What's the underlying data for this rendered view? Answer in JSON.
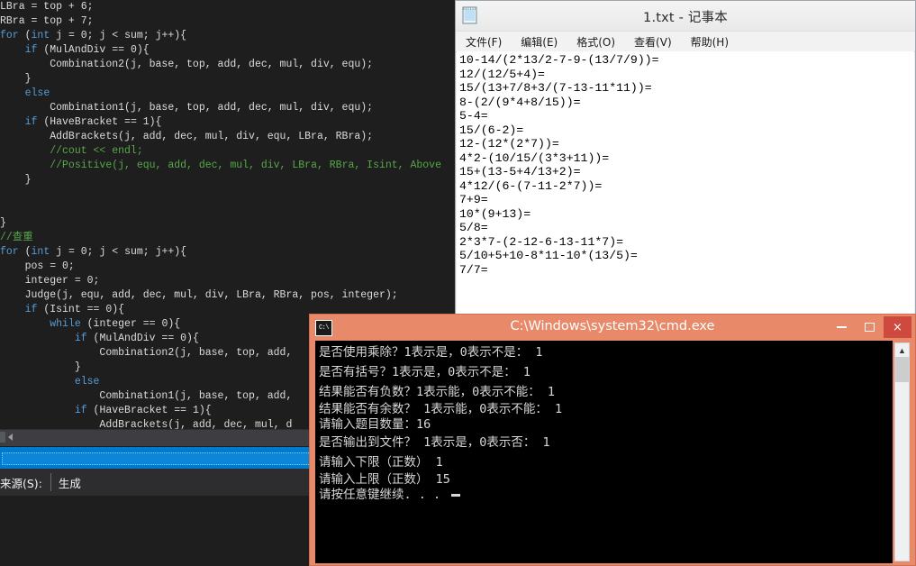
{
  "vs": {
    "code_lines": [
      [
        {
          "t": "LBra = top + 6;",
          "c": ""
        }
      ],
      [
        {
          "t": "RBra = top + 7;",
          "c": ""
        }
      ],
      [
        {
          "t": "for",
          "c": "k"
        },
        {
          "t": " (",
          "c": ""
        },
        {
          "t": "int",
          "c": "k"
        },
        {
          "t": " j = 0; j < sum; j++){",
          "c": ""
        }
      ],
      [
        {
          "t": "    ",
          "c": ""
        },
        {
          "t": "if",
          "c": "k"
        },
        {
          "t": " (MulAndDiv == 0){",
          "c": ""
        }
      ],
      [
        {
          "t": "        Combination2(j, base, top, add, dec, mul, div, equ);",
          "c": ""
        }
      ],
      [
        {
          "t": "    }",
          "c": ""
        }
      ],
      [
        {
          "t": "    ",
          "c": ""
        },
        {
          "t": "else",
          "c": "k"
        }
      ],
      [
        {
          "t": "        Combination1(j, base, top, add, dec, mul, div, equ);",
          "c": ""
        }
      ],
      [
        {
          "t": "    ",
          "c": ""
        },
        {
          "t": "if",
          "c": "k"
        },
        {
          "t": " (HaveBracket == 1){",
          "c": ""
        }
      ],
      [
        {
          "t": "        AddBrackets(j, add, dec, mul, div, equ, LBra, RBra);",
          "c": ""
        }
      ],
      [
        {
          "t": "        ",
          "c": ""
        },
        {
          "t": "//cout << endl;",
          "c": "cm"
        }
      ],
      [
        {
          "t": "        ",
          "c": ""
        },
        {
          "t": "//Positive(j, equ, add, dec, mul, div, LBra, RBra, Isint, Above",
          "c": "cm"
        }
      ],
      [
        {
          "t": "    }",
          "c": ""
        }
      ],
      [
        {
          "t": "",
          "c": ""
        }
      ],
      [
        {
          "t": "",
          "c": ""
        }
      ],
      [
        {
          "t": "}",
          "c": ""
        }
      ],
      [
        {
          "t": "//查重",
          "c": "cm"
        }
      ],
      [
        {
          "t": "for",
          "c": "k"
        },
        {
          "t": " (",
          "c": ""
        },
        {
          "t": "int",
          "c": "k"
        },
        {
          "t": " j = 0; j < sum; j++){",
          "c": ""
        }
      ],
      [
        {
          "t": "    pos = 0;",
          "c": ""
        }
      ],
      [
        {
          "t": "    integer = 0;",
          "c": ""
        }
      ],
      [
        {
          "t": "    Judge(j, equ, add, dec, mul, div, LBra, RBra, pos, integer);",
          "c": ""
        }
      ],
      [
        {
          "t": "    ",
          "c": ""
        },
        {
          "t": "if",
          "c": "k"
        },
        {
          "t": " (Isint == 0){",
          "c": ""
        }
      ],
      [
        {
          "t": "        ",
          "c": ""
        },
        {
          "t": "while",
          "c": "k"
        },
        {
          "t": " (integer == 0){",
          "c": ""
        }
      ],
      [
        {
          "t": "            ",
          "c": ""
        },
        {
          "t": "if",
          "c": "k"
        },
        {
          "t": " (MulAndDiv == 0){",
          "c": ""
        }
      ],
      [
        {
          "t": "                Combination2(j, base, top, add, ",
          "c": ""
        }
      ],
      [
        {
          "t": "            }",
          "c": ""
        }
      ],
      [
        {
          "t": "            ",
          "c": ""
        },
        {
          "t": "else",
          "c": "k"
        }
      ],
      [
        {
          "t": "                Combination1(j, base, top, add,",
          "c": ""
        }
      ],
      [
        {
          "t": "            ",
          "c": ""
        },
        {
          "t": "if",
          "c": "k"
        },
        {
          "t": " (HaveBracket == 1){",
          "c": ""
        }
      ],
      [
        {
          "t": "                AddBrackets(j, add, dec, mul, d",
          "c": ""
        }
      ],
      [
        {
          "t": "            }",
          "c": ""
        }
      ]
    ],
    "source_label": "来源(S):",
    "source_value": "生成"
  },
  "notepad": {
    "title": "1.txt - 记事本",
    "icon": "notepad-icon",
    "menu": [
      {
        "label": "文件(F)"
      },
      {
        "label": "编辑(E)"
      },
      {
        "label": "格式(O)"
      },
      {
        "label": "查看(V)"
      },
      {
        "label": "帮助(H)"
      }
    ],
    "lines": [
      "10-14/(2*13/2-7-9-(13/7/9))=",
      "12/(12/5+4)=",
      "15/(13+7/8+3/(7-13-11*11))=",
      "8-(2/(9*4+8/15))=",
      "5-4=",
      "15/(6-2)=",
      "12-(12*(2*7))=",
      "4*2-(10/15/(3*3+11))=",
      "15+(13-5+4/13+2)=",
      "4*12/(6-(7-11-2*7))=",
      "7+9=",
      "10*(9+13)=",
      "5/8=",
      "2*3*7-(2-12-6-13-11*7)=",
      "5/10+5+10-8*11-10*(13/5)=",
      "7/7="
    ]
  },
  "cmd": {
    "title": "C:\\Windows\\system32\\cmd.exe",
    "icon": "cmd-icon",
    "minimize_label": "最小化",
    "maximize_label": "最大化",
    "close_label": "×",
    "lines": [
      {
        "text": "是否使用乘除？1表示是，0表示不是： 1",
        "spacing": "normal"
      },
      {
        "text": "是否有括号？1表示是，0表示不是： 1",
        "spacing": "normal"
      },
      {
        "text": "结果能否有负数？1表示能，0表示不能： 1",
        "spacing": "normal"
      },
      {
        "text": "结果能否有余数？ 1表示能，0表示不能： 1",
        "spacing": "tight"
      },
      {
        "text": "请输入题目数量：16",
        "spacing": "tight"
      },
      {
        "text": "是否输出到文件？ 1表示是，0表示否： 1",
        "spacing": "normal"
      },
      {
        "text": "请输入下限（正数） 1",
        "spacing": "normal"
      },
      {
        "text": "请输入上限（正数） 15",
        "spacing": "tight"
      },
      {
        "text": "请按任意键继续. . . ",
        "spacing": "tight",
        "cursor": true
      }
    ]
  },
  "colors": {
    "vs_background": "#1e1e1e",
    "vs_accent_blue": "#007acc",
    "keyword_blue": "#569cd6",
    "comment_green": "#57a64a",
    "cmd_titlebar": "#e8896a",
    "cmd_close_red": "#cf4a3e"
  }
}
